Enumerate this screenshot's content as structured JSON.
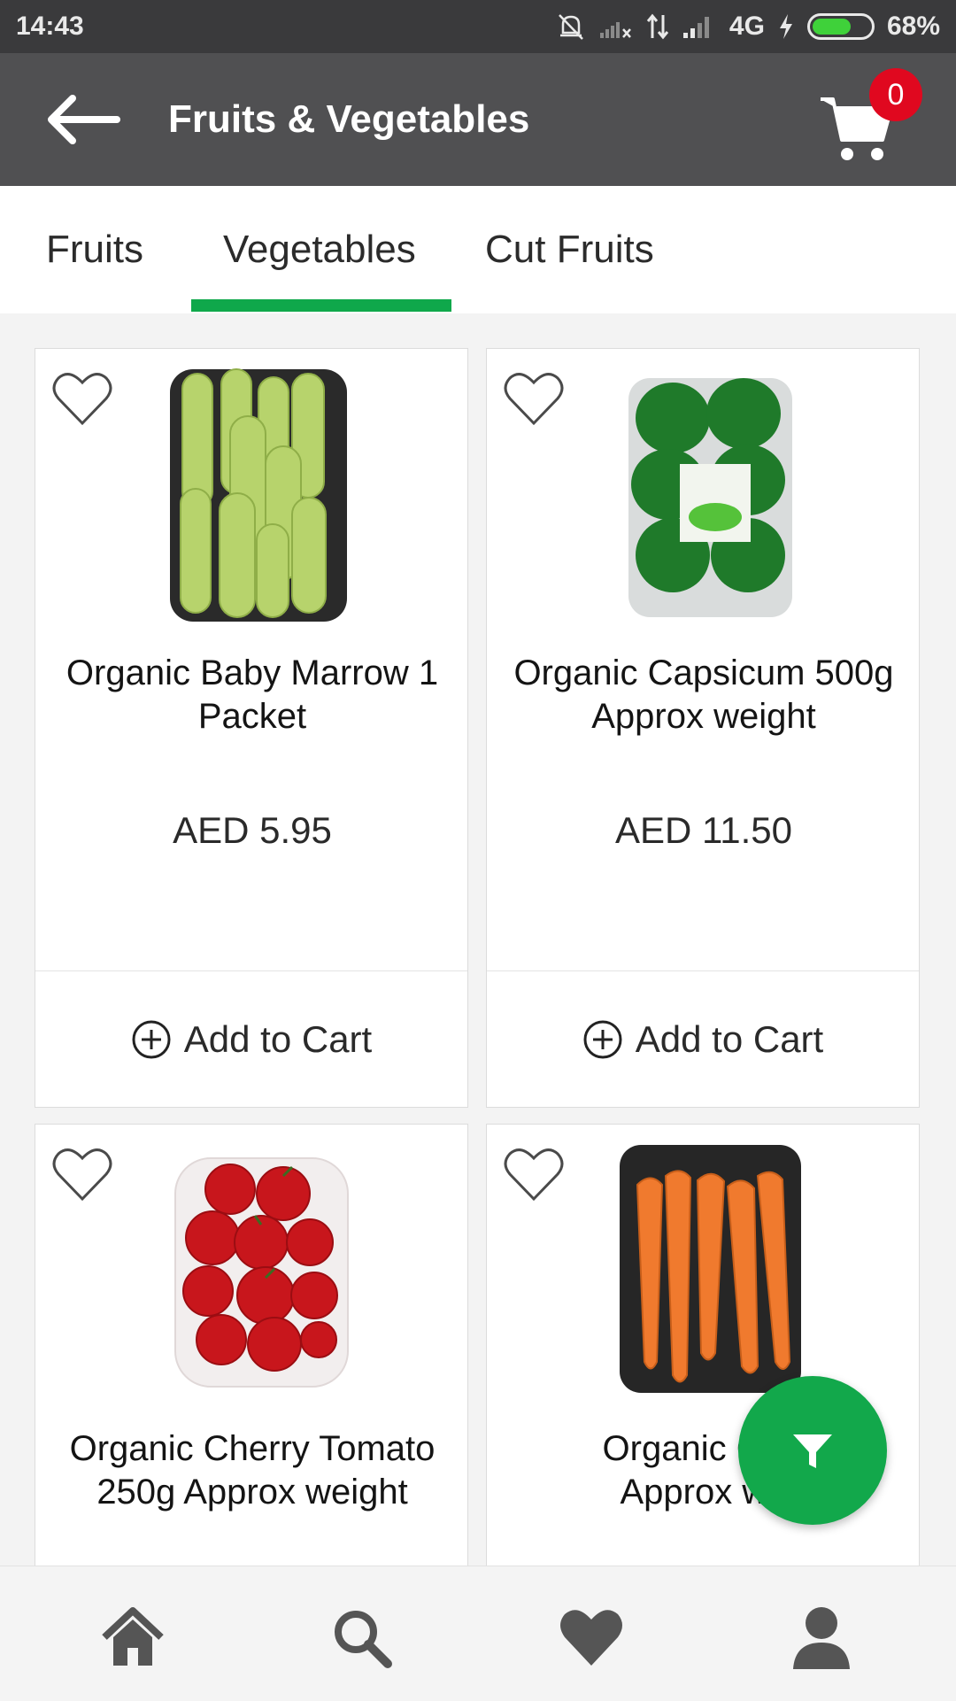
{
  "status_bar": {
    "time": "14:43",
    "network": "4G",
    "battery": "68%",
    "battery_level": 0.68,
    "icons": [
      "mute-bell-icon",
      "signal-no-sim-icon",
      "data-arrows-icon",
      "signal-icon",
      "charging-icon",
      "battery-icon"
    ]
  },
  "app_bar": {
    "title": "Fruits & Vegetables",
    "cart_count": "0",
    "icons": [
      "back-arrow-icon",
      "cart-icon"
    ]
  },
  "tabs": [
    {
      "label": "Fruits",
      "selected": false
    },
    {
      "label": "Vegetables",
      "selected": true
    },
    {
      "label": "Cut Fruits",
      "selected": false
    }
  ],
  "accent_color": "#0fa84b",
  "products": [
    {
      "name": "Organic Baby Marrow 1 Packet",
      "price": "AED 5.95",
      "image": "baby-marrow-packet",
      "add_label": "Add to Cart"
    },
    {
      "name": "Organic Capsicum 500g Approx weight",
      "price": "AED 11.50",
      "image": "capsicum-packet",
      "add_label": "Add to Cart"
    },
    {
      "name": "Organic Cherry Tomato 250g Approx weight",
      "image": "cherry-tomato-packet"
    },
    {
      "name": "Organic Carr",
      "name_line2": "Approx we",
      "image": "carrot-packet"
    }
  ],
  "fab": {
    "icon": "filter-icon"
  },
  "bottom_nav": [
    {
      "icon": "home-icon"
    },
    {
      "icon": "search-icon"
    },
    {
      "icon": "heart-icon"
    },
    {
      "icon": "profile-icon"
    }
  ]
}
